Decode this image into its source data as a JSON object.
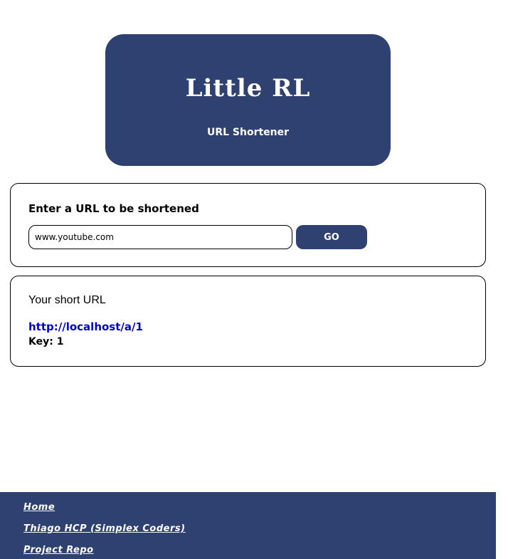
{
  "header": {
    "title": "Little RL",
    "subtitle": "URL Shortener"
  },
  "form": {
    "label": "Enter a URL to be shortened",
    "input_value": "www.youtube.com",
    "button_label": "GO"
  },
  "result": {
    "heading": "Your short URL",
    "short_url": "http://localhost/a/1",
    "key_text": "Key: 1"
  },
  "footer": {
    "links": [
      "Home",
      "Thiago HCP (Simplex Coders)",
      "Project Repo"
    ]
  },
  "colors": {
    "brand": "#2e4170",
    "link": "#0000cc"
  }
}
